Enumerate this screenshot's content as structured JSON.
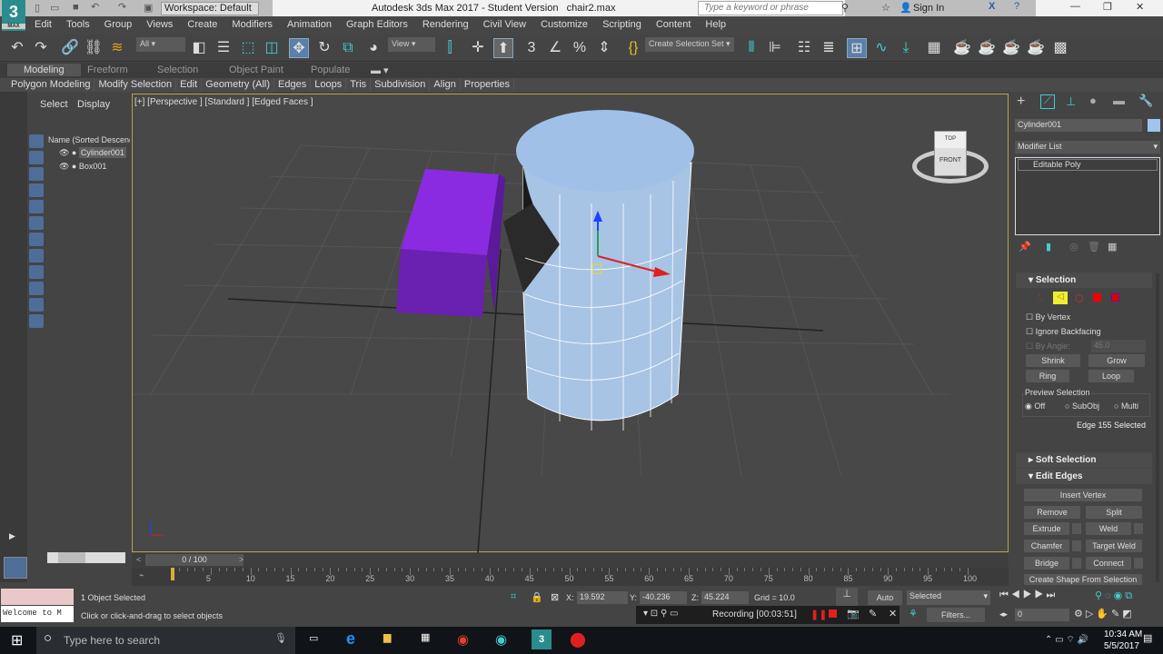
{
  "titlebar": {
    "title": "Autodesk 3ds Max 2017 - Student Version",
    "file": "chair2.max",
    "workspace": "Workspace: Default",
    "search_placeholder": "Type a keyword or phrase",
    "sign_in": "Sign In",
    "logo": "3",
    "logo_sub": "MAX"
  },
  "menu": [
    "Edit",
    "Tools",
    "Group",
    "Views",
    "Create",
    "Modifiers",
    "Animation",
    "Graph Editors",
    "Rendering",
    "Civil View",
    "Customize",
    "Scripting",
    "Content",
    "Help"
  ],
  "toolbar": {
    "filter": "All",
    "ref_coord": "View",
    "selection_set": "Create Selection Set"
  },
  "ribbon_tabs": [
    "Modeling",
    "Freeform",
    "Selection",
    "Object Paint",
    "Populate"
  ],
  "ribbon_items": [
    "Polygon Modeling",
    "Modify Selection",
    "Edit",
    "Geometry (All)",
    "Edges",
    "Loops",
    "Tris",
    "Subdivision",
    "Align",
    "Properties"
  ],
  "explorer": {
    "tabs": [
      "Select",
      "Display"
    ],
    "column": "Name (Sorted Descending)",
    "items": [
      "Cylinder001",
      "Box001"
    ]
  },
  "viewport": {
    "label": "[+] [Perspective ] [Standard ] [Edged Faces ]",
    "viewcube_top": "TOP",
    "viewcube_front": "FRONT",
    "accent_box": "#7a22c8",
    "cylinder_color": "#a8c4e4"
  },
  "cmdpanel": {
    "object_name": "Cylinder001",
    "object_color": "#a0c4ec",
    "modifier_list": "Modifier List",
    "stack": [
      "Editable Poly"
    ],
    "selection": {
      "title": "Selection",
      "by_vertex": "By Vertex",
      "ignore_backfacing": "Ignore Backfacing",
      "by_angle": "By Angle:",
      "angle_value": "45.0",
      "shrink": "Shrink",
      "grow": "Grow",
      "ring": "Ring",
      "loop": "Loop",
      "preview": "Preview Selection",
      "off": "Off",
      "subobj": "SubObj",
      "multi": "Multi",
      "status": "Edge 155 Selected"
    },
    "soft_selection": "Soft Selection",
    "edit_edges": {
      "title": "Edit Edges",
      "insert_vertex": "Insert Vertex",
      "remove": "Remove",
      "split": "Split",
      "extrude": "Extrude",
      "weld": "Weld",
      "chamfer": "Chamfer",
      "target_weld": "Target Weld",
      "bridge": "Bridge",
      "connect": "Connect",
      "create_shape": "Create Shape From Selection"
    }
  },
  "timeline": {
    "frame": "0 / 100",
    "ticks": [
      "5",
      "10",
      "15",
      "20",
      "25",
      "30",
      "35",
      "40",
      "45",
      "50",
      "55",
      "60",
      "65",
      "70",
      "75",
      "80",
      "85",
      "90",
      "95",
      "100"
    ],
    "progress": 0
  },
  "status": {
    "maxscript": "Welcome to M",
    "selected": "1 Object Selected",
    "prompt": "Click or click-and-drag to select objects",
    "x_label": "X:",
    "x": "19.592",
    "y_label": "Y:",
    "y": "-40.236",
    "z_label": "Z:",
    "z": "45.224",
    "grid": "Grid = 10.0",
    "auto": "Auto",
    "key_mode": "Selected",
    "recording": "Recording [00:03:51]",
    "filters": "Filters...",
    "frame_field": "0"
  },
  "taskbar": {
    "search": "Type here to search",
    "time": "10:34 AM",
    "date": "5/5/2017"
  }
}
